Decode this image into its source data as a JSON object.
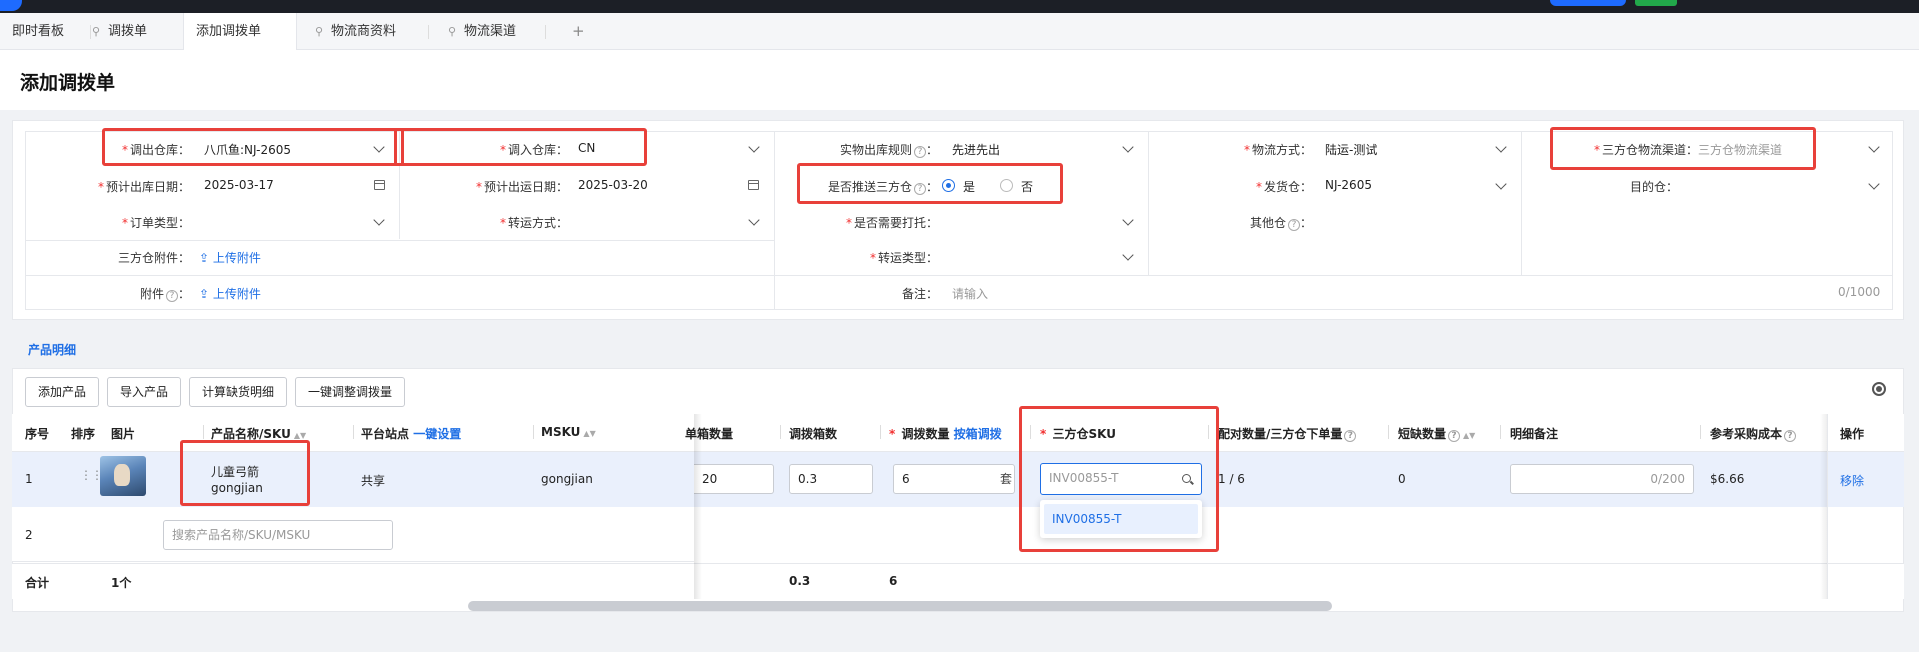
{
  "tabs": [
    {
      "label": "即时看板",
      "pinned": false
    },
    {
      "label": "调拨单",
      "pinned": true
    },
    {
      "label": "添加调拨单",
      "pinned": false,
      "active": true
    },
    {
      "label": "物流商资料",
      "pinned": true
    },
    {
      "label": "物流渠道",
      "pinned": true
    }
  ],
  "tab_add": "+",
  "page_title": "添加调拨单",
  "form": {
    "out_warehouse": {
      "label": "调出仓库：",
      "value": "八爪鱼:NJ-2605"
    },
    "in_warehouse": {
      "label": "调入仓库：",
      "value": "CN"
    },
    "stock_rule": {
      "label": "实物出库规则",
      "value": "先进先出"
    },
    "logistics_mode": {
      "label": "物流方式：",
      "value": "陆运-测试"
    },
    "tpl_channel": {
      "label": "三方仓物流渠道：",
      "placeholder": "三方仓物流渠道"
    },
    "est_out_date": {
      "label": "预计出库日期：",
      "value": "2025-03-17"
    },
    "est_ship_date": {
      "label": "预计出运日期：",
      "value": "2025-03-20"
    },
    "push_tpl": {
      "label": "是否推送三方仓",
      "yes": "是",
      "no": "否",
      "selected": "是"
    },
    "ship_from": {
      "label": "发货仓：",
      "value": "NJ-2605"
    },
    "dest": {
      "label": "目的仓："
    },
    "order_type": {
      "label": "订单类型："
    },
    "transfer_mode": {
      "label": "转运方式："
    },
    "pallet": {
      "label": "是否需要打托："
    },
    "other_wh": {
      "label": "其他仓"
    },
    "tpl_attach": {
      "label": "三方仓附件：",
      "action": "上传附件"
    },
    "transfer_type": {
      "label": "转运类型："
    },
    "attach": {
      "label": "附件",
      "action": "上传附件"
    },
    "remark": {
      "label": "备注：",
      "placeholder": "请输入",
      "counter": "0/1000"
    }
  },
  "product_section": {
    "title": "产品明细",
    "buttons": [
      "添加产品",
      "导入产品",
      "计算缺货明细",
      "一键调整调拨量"
    ]
  },
  "table": {
    "headers": {
      "seq": "序号",
      "sort": "排序",
      "image": "图片",
      "name_sku": "产品名称/SKU",
      "platform": "平台站点",
      "platform_link": "一键设置",
      "msku": "MSKU",
      "per_box": "单箱数量",
      "boxes": "调拨箱数",
      "qty": "调拨数量",
      "qty_link": "按箱调拨",
      "tpl_sku": "三方仓SKU",
      "pair": "配对数量/三方仓下单量",
      "shortage": "短缺数量",
      "detail_remark": "明细备注",
      "ref_cost": "参考采购成本",
      "ops": "操作"
    },
    "rows": [
      {
        "seq": "1",
        "name": "儿童弓箭",
        "sku": "gongjian",
        "platform": "共享",
        "msku": "gongjian",
        "per_box": "20",
        "boxes": "0.3",
        "qty": "6",
        "qty_unit": "套",
        "tpl_sku": "INV00855-T",
        "pair": "1 / 6",
        "shortage": "0",
        "remark_counter": "0/200",
        "ref_cost": "$6.66",
        "action": "移除"
      }
    ],
    "new_row": {
      "seq": "2",
      "search_placeholder": "搜索产品名称/SKU/MSKU"
    },
    "dropdown_option": "INV00855-T",
    "summary": {
      "label": "合计",
      "count": "1个",
      "boxes": "0.3",
      "qty": "6"
    }
  }
}
